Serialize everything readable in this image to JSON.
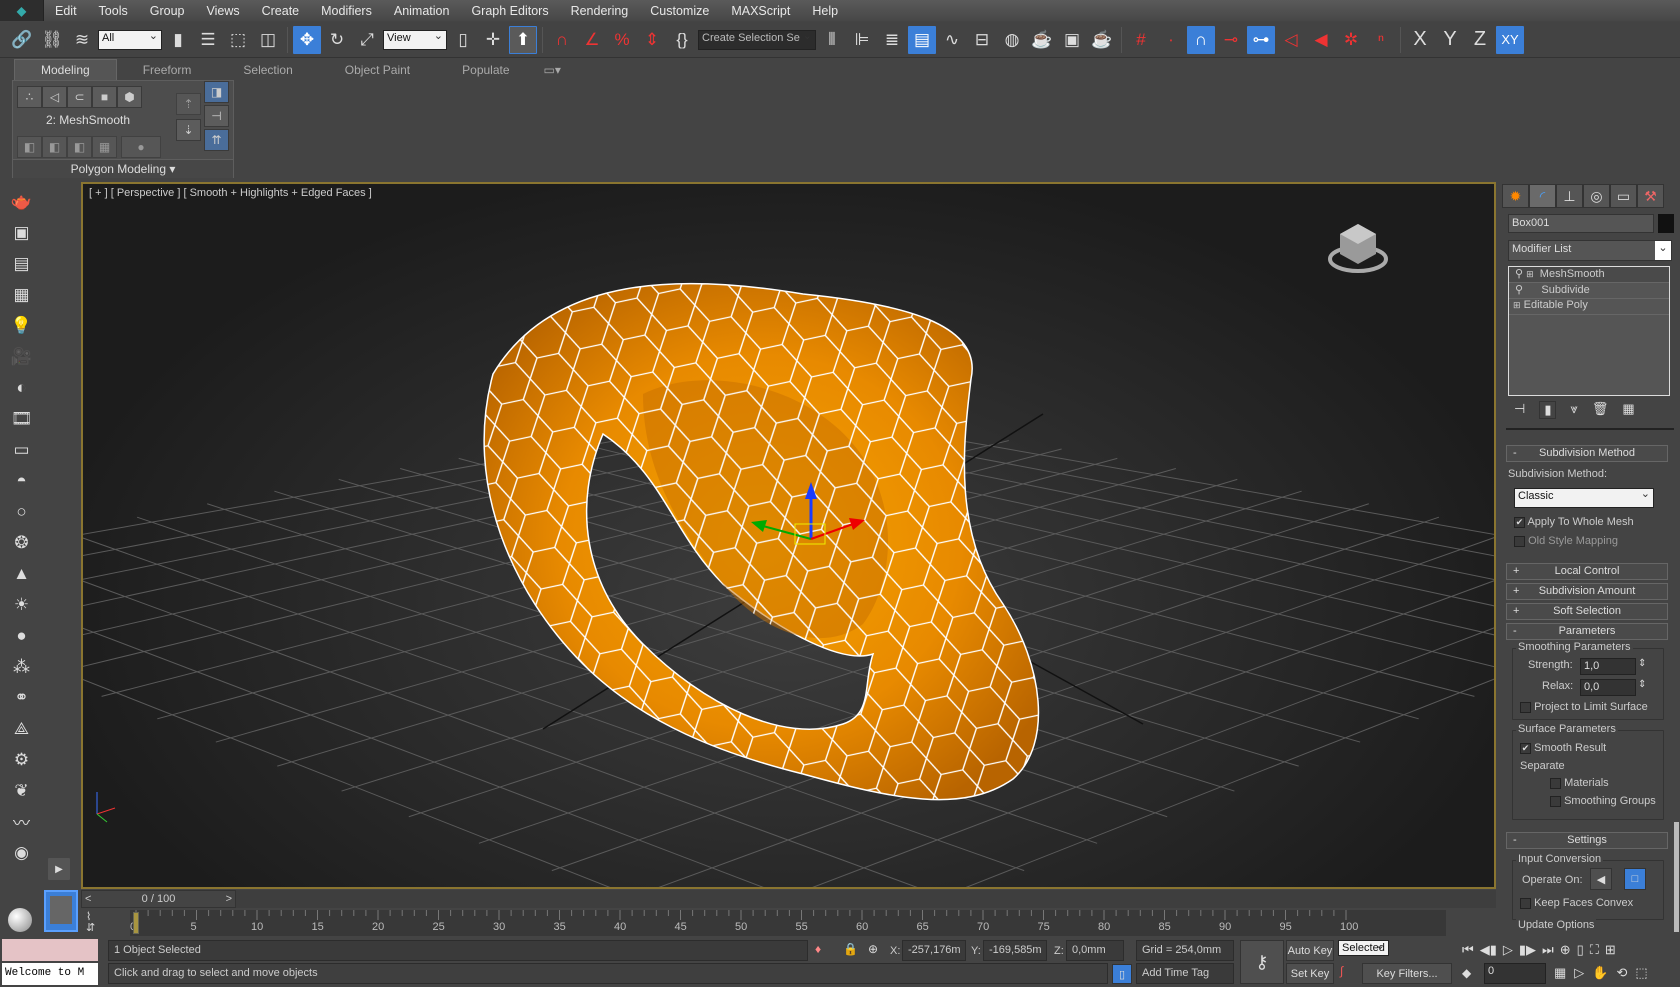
{
  "menu": [
    "Edit",
    "Tools",
    "Group",
    "Views",
    "Create",
    "Modifiers",
    "Animation",
    "Graph Editors",
    "Rendering",
    "Customize",
    "MAXScript",
    "Help"
  ],
  "toolbar": {
    "selection_filter": "All",
    "ref_coord": "View",
    "named_selection": "Create Selection Se",
    "axis": [
      "X",
      "Y",
      "Z",
      "XY"
    ],
    "icons_left": [
      "select-and-link-icon",
      "unlink-icon",
      "bind-space-warp-icon"
    ],
    "icons_mid": [
      "select-object-icon",
      "select-by-name-icon",
      "rectangle-selection-icon",
      "window-crossing-icon",
      "move-icon",
      "rotate-icon",
      "scale-icon"
    ],
    "icons_right": [
      "mirror-icon",
      "align-icon",
      "layer-explorer-icon",
      "scene-explorer-icon",
      "curve-editor-icon",
      "schematic-view-icon",
      "material-editor-icon",
      "render-setup-icon",
      "render-frame-icon",
      "render-icon",
      "snap-grid-icon",
      "snap-vertex-icon",
      "snap-endpoint-icon",
      "snap-edge-icon",
      "snap-midpoint-icon",
      "snap-face-icon",
      "snap-pivot-icon",
      "snap-bbox-icon",
      "snap-axis-icon"
    ]
  },
  "ribbon": {
    "tabs": [
      "Modeling",
      "Freeform",
      "Selection",
      "Object Paint",
      "Populate"
    ],
    "active_tab": "Modeling",
    "modifier": "2: MeshSmooth",
    "panel_title": "Polygon Modeling"
  },
  "viewport": {
    "label": "[ + ] [ Perspective ] [ Smooth + Highlights + Edged Faces ]",
    "object_color": "#f29a00",
    "border_color": "#8a7530"
  },
  "command_panel": {
    "object_name": "Box001",
    "modifier_list": "Modifier List",
    "stack": [
      "MeshSmooth",
      "Subdivide",
      "Editable Poly"
    ],
    "rollouts": {
      "subdivision_method": {
        "title": "Subdivision Method",
        "label": "Subdivision Method:",
        "value": "Classic",
        "apply_whole": "Apply To Whole Mesh",
        "apply_whole_checked": true,
        "old_style": "Old Style Mapping",
        "old_style_checked": false
      },
      "local_control": "Local Control",
      "subdivision_amount": "Subdivision Amount",
      "soft_selection": "Soft Selection",
      "parameters": {
        "title": "Parameters",
        "smoothing_group": "Smoothing Parameters",
        "strength_label": "Strength:",
        "strength": "1,0",
        "relax_label": "Relax:",
        "relax": "0,0",
        "project": "Project to Limit Surface",
        "surface_group": "Surface Parameters",
        "smooth_result": "Smooth Result",
        "separate": "Separate",
        "materials": "Materials",
        "smoothing_groups": "Smoothing Groups"
      },
      "settings": {
        "title": "Settings",
        "input_conversion": "Input Conversion",
        "operate_on": "Operate On:",
        "keep_convex": "Keep Faces Convex",
        "update_options": "Update Options"
      }
    }
  },
  "timeline": {
    "frame": "0 / 100",
    "ticks": [
      "0",
      "5",
      "10",
      "15",
      "20",
      "25",
      "30",
      "35",
      "40",
      "45",
      "50",
      "55",
      "60",
      "65",
      "70",
      "75",
      "80",
      "85",
      "90",
      "95",
      "100"
    ],
    "current_frame_fraction": 0
  },
  "status": {
    "listener": "Welcome to M",
    "selected": "1 Object Selected",
    "prompt": "Click and drag to select and move objects",
    "x_label": "X:",
    "x": "-257,176m",
    "y_label": "Y:",
    "y": "-169,585m",
    "z_label": "Z:",
    "z": "0,0mm",
    "grid": "Grid = 254,0mm",
    "add_time_tag": "Add Time Tag",
    "auto_key": "Auto Key",
    "set_key": "Set Key",
    "key_mode": "Selected",
    "key_filters": "Key Filters...",
    "frame_field": "0"
  }
}
